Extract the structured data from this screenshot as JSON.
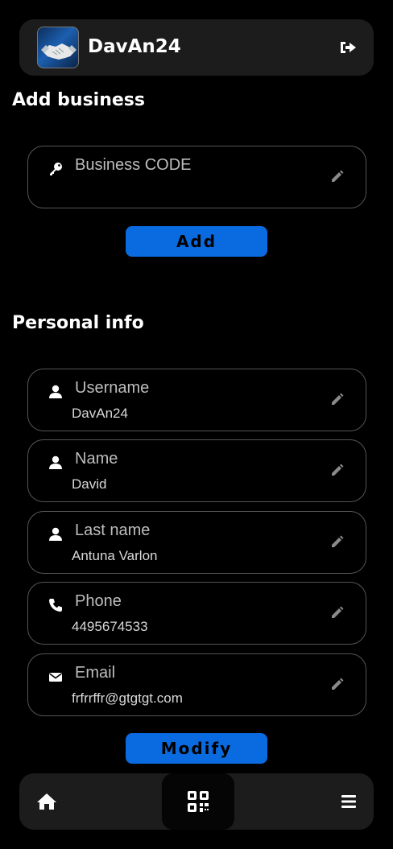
{
  "header": {
    "username": "DavAn24",
    "avatar_icon": "handshake-logo",
    "logout_icon": "sign-out-icon"
  },
  "add_business": {
    "title": "Add business",
    "code_field": {
      "label": "Business CODE",
      "value": "",
      "icon": "key-icon"
    },
    "button_label": "Add"
  },
  "personal_info": {
    "title": "Personal info",
    "fields": [
      {
        "label": "Username",
        "value": "DavAn24",
        "icon": "user-icon"
      },
      {
        "label": "Name",
        "value": "David",
        "icon": "user-icon"
      },
      {
        "label": "Last name",
        "value": "Antuna Varlon",
        "icon": "user-icon"
      },
      {
        "label": "Phone",
        "value": "4495674533",
        "icon": "phone-icon"
      },
      {
        "label": "Email",
        "value": "frfrrffr@gtgtgt.com",
        "icon": "envelope-icon"
      }
    ],
    "button_label": "Modify"
  },
  "navbar": {
    "home_icon": "home-icon",
    "qr_icon": "qr-code-icon",
    "menu_icon": "hamburger-menu-icon"
  },
  "colors": {
    "background": "#000000",
    "surface": "#1c1c1c",
    "accent": "#0a6be0",
    "field_border": "#555555"
  }
}
